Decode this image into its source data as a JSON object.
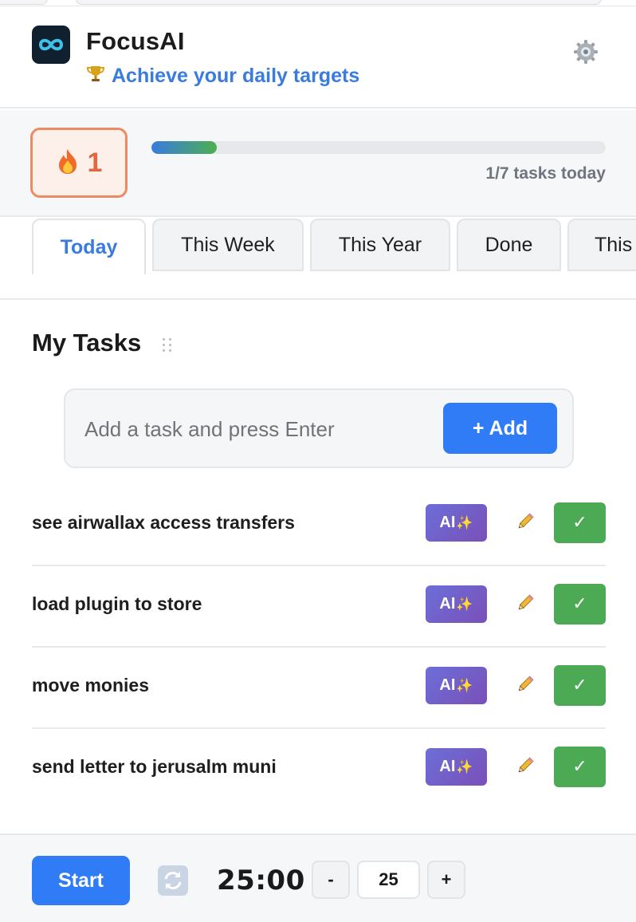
{
  "header": {
    "title": "FocusAI",
    "subtitle": "Achieve your daily targets",
    "subtitle_icon": "trophy-icon",
    "logo_icon": "infinity-icon",
    "settings_icon": "gear-icon"
  },
  "streak": {
    "icon": "fire-icon",
    "count": "1",
    "progress_fraction": 0.143,
    "progress_text": "1/7 tasks today"
  },
  "tabs": [
    {
      "label": "Today",
      "active": true
    },
    {
      "label": "This Week",
      "active": false
    },
    {
      "label": "This Year",
      "active": false
    },
    {
      "label": "Done",
      "active": false
    },
    {
      "label": "This",
      "active": false
    }
  ],
  "tasks_section": {
    "title": "My Tasks",
    "input_placeholder": "Add a task and press Enter",
    "add_label": "+ Add"
  },
  "tasks": [
    {
      "text": "see airwallax access transfers",
      "ai_label": "AI",
      "done_label": "✓"
    },
    {
      "text": "load plugin to store",
      "ai_label": "AI",
      "done_label": "✓"
    },
    {
      "text": "move monies",
      "ai_label": "AI",
      "done_label": "✓"
    },
    {
      "text": "send letter to jerusalm muni",
      "ai_label": "AI",
      "done_label": "✓"
    }
  ],
  "timer": {
    "start_label": "Start",
    "reset_icon": "refresh-icon",
    "time": "25:00",
    "minus_label": "-",
    "minutes": "25",
    "plus_label": "+"
  },
  "colors": {
    "accent": "#2f7cf6",
    "link": "#3a7be0",
    "streak": "#e0673e",
    "done": "#4caa55",
    "ai": "#6c6fd8"
  }
}
